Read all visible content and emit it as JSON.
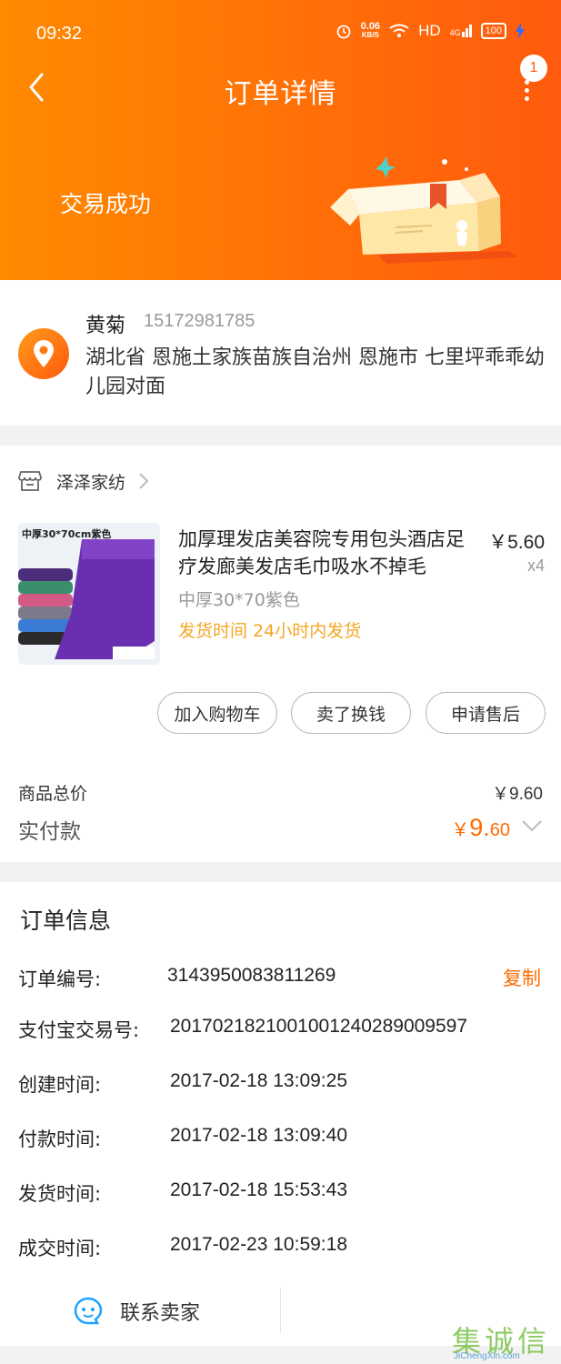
{
  "status_bar": {
    "time": "09:32",
    "net_speed_value": "0.06",
    "net_speed_unit": "KB/S",
    "hd": "HD",
    "signal": "4G",
    "battery": "100"
  },
  "header": {
    "title": "订单详情",
    "badge_count": "1",
    "status": "交易成功",
    "bg_from": "#ff8a00",
    "bg_to": "#ff5a0e"
  },
  "address": {
    "name": "黄菊",
    "phone": "15172981785",
    "detail": "湖北省 恩施土家族苗族自治州 恩施市 七里坪乖乖幼儿园对面"
  },
  "shop": {
    "name": "泽泽家纺"
  },
  "product": {
    "thumb_label": "中厚30*70cm紫色",
    "title": "加厚理发店美容院专用包头酒店足疗发廊美发店毛巾吸水不掉毛",
    "price": "￥5.60",
    "qty": "x4",
    "sku": "中厚30*70紫色",
    "shipping": "发货时间 24小时内发货"
  },
  "actions": {
    "add_cart": "加入购物车",
    "resell": "卖了换钱",
    "after_sale": "申请售后"
  },
  "totals": {
    "goods_label": "商品总价",
    "goods_value": "￥9.60",
    "paid_label": "实付款",
    "paid_currency": "￥",
    "paid_int": "9.",
    "paid_dec": "60",
    "accent": "#ff6a00"
  },
  "order_info": {
    "title": "订单信息",
    "copy_label": "复制",
    "rows": [
      {
        "label": "订单编号:",
        "value": "3143950083811269"
      },
      {
        "label": "支付宝交易号:",
        "value": "2017021821001001240289009597"
      },
      {
        "label": "创建时间:",
        "value": "2017-02-18 13:09:25"
      },
      {
        "label": "付款时间:",
        "value": "2017-02-18 13:09:40"
      },
      {
        "label": "发货时间:",
        "value": "2017-02-18 15:53:43"
      },
      {
        "label": "成交时间:",
        "value": "2017-02-23 10:59:18"
      }
    ]
  },
  "footer": {
    "contact_seller": "联系卖家"
  },
  "watermark": {
    "text": "集诚信",
    "sub": "JiChengXin.com"
  }
}
